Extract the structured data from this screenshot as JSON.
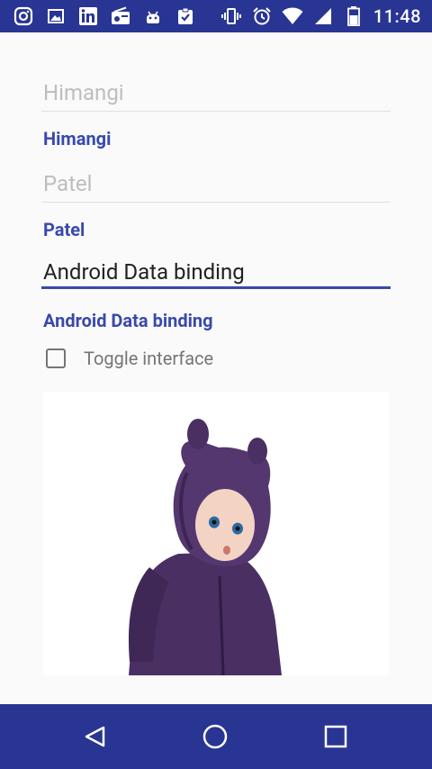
{
  "status_bar": {
    "time": "11:48",
    "left_icons": [
      "instagram-icon",
      "image-icon",
      "linkedin-icon",
      "radio-icon",
      "android-icon",
      "clipboard-check-icon"
    ],
    "right_icons": [
      "vibrate-icon",
      "alarm-icon",
      "wifi-icon",
      "signal-icon",
      "battery-icon"
    ]
  },
  "form": {
    "first_name_placeholder": "Himangi",
    "first_name_display": "Himangi",
    "last_name_placeholder": "Patel",
    "last_name_display": "Patel",
    "message_value": "Android Data binding",
    "message_display": "Android Data binding",
    "toggle_label": "Toggle interface",
    "toggle_checked": false
  },
  "colors": {
    "primary_dark": "#283593",
    "accent": "#3949ab"
  },
  "navigation": {
    "buttons": [
      "back-icon",
      "home-icon",
      "recents-icon"
    ]
  }
}
